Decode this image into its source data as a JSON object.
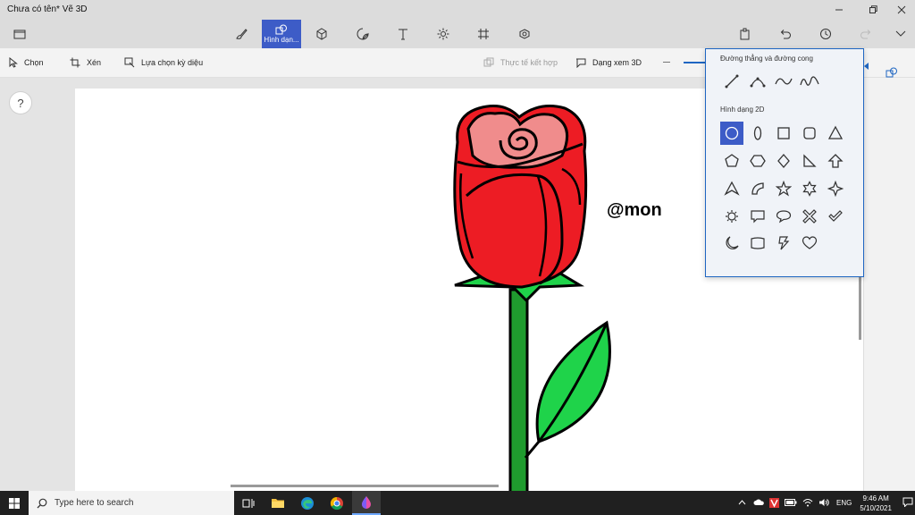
{
  "window": {
    "title": "Chưa có tên*   Vẽ 3D"
  },
  "ribbon": {
    "tools": [
      {
        "id": "brushes",
        "icon": "brush-icon"
      },
      {
        "id": "2d-shapes",
        "icon": "2d-shapes-icon",
        "label": "Hình dạn..."
      },
      {
        "id": "3d-shapes",
        "icon": "cube-icon"
      },
      {
        "id": "stickers",
        "icon": "sticker-icon"
      },
      {
        "id": "text",
        "icon": "text-icon"
      },
      {
        "id": "effects",
        "icon": "effects-icon"
      },
      {
        "id": "canvas",
        "icon": "canvas-icon"
      },
      {
        "id": "3d-library",
        "icon": "3d-library-icon"
      }
    ]
  },
  "subbar": {
    "select": "Chọn",
    "crop": "Xén",
    "magic_select": "Lựa chọn kỳ diệu",
    "mixed_reality": "Thực tế kết hợp",
    "view_3d": "Dạng xem 3D"
  },
  "help": {
    "label": "?"
  },
  "canvas": {
    "watermark": "@mon"
  },
  "flyout": {
    "lines_title": "Đường thẳng và đường cong",
    "shapes_title": "Hình dạng 2D",
    "selected_shape": "circle"
  },
  "taskbar": {
    "search_placeholder": "Type here to search",
    "language": "ENG",
    "time": "9:46 AM",
    "date": "5/10/2021"
  },
  "colors": {
    "accent": "#3d5cc7",
    "rose_red": "#ed1c24",
    "rose_pink": "#f08c8c",
    "stem_green": "#1f9b2e",
    "leaf_green": "#1fd34a"
  }
}
